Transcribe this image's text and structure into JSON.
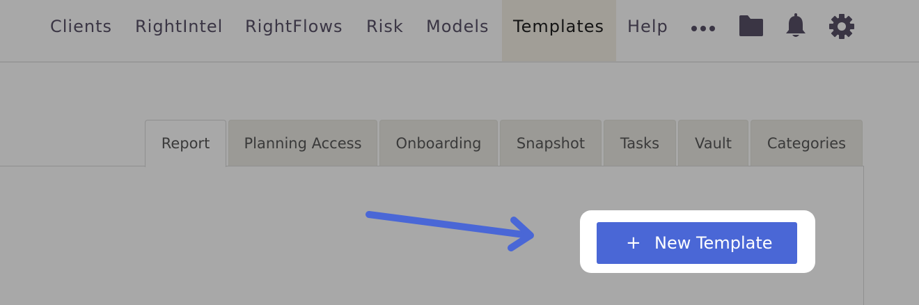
{
  "nav": {
    "items": [
      "Clients",
      "RightIntel",
      "RightFlows",
      "Risk",
      "Models",
      "Templates",
      "Help"
    ],
    "active": "Templates",
    "icons": [
      "more-icon",
      "folder-icon",
      "bell-icon",
      "gear-icon"
    ]
  },
  "tabs": {
    "items": [
      "Report",
      "Planning Access",
      "Onboarding",
      "Snapshot",
      "Tasks",
      "Vault",
      "Categories"
    ],
    "active": "Report"
  },
  "actions": {
    "new_template_label": "New Template",
    "plus_glyph": "+"
  },
  "colors": {
    "accent_button": "#4a67d6",
    "annotation_arrow": "#4a67d6",
    "highlight": "#ffffff"
  }
}
